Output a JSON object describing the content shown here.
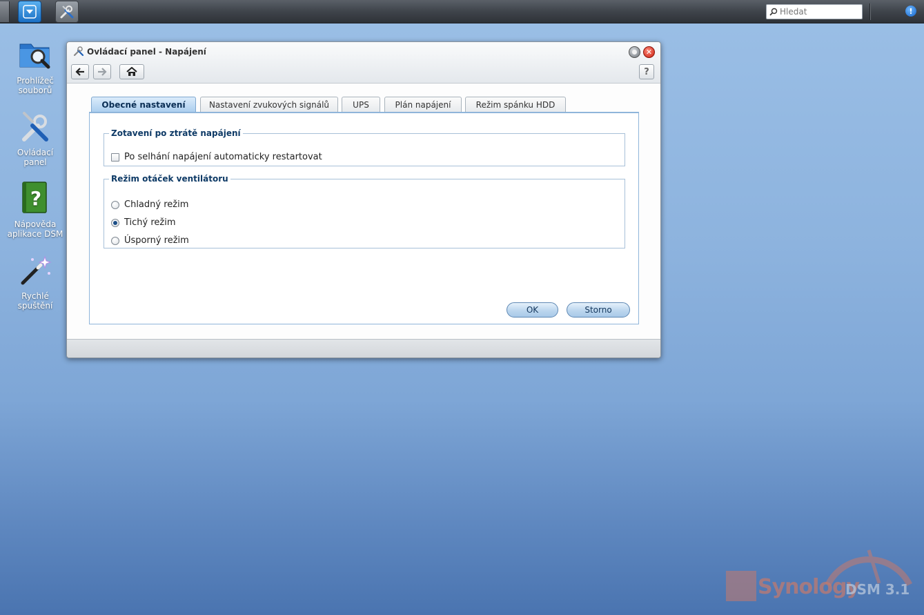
{
  "taskbar": {
    "search_placeholder": "Hledat",
    "start_icon": "chevron-down-icon",
    "app_icon": "tools-icon",
    "notify_icon": "info-icon",
    "notify_glyph": "!"
  },
  "desktop": {
    "icons": [
      {
        "label_line1": "Prohlížeč",
        "label_line2": "souborů",
        "icon": "folder-search-icon"
      },
      {
        "label_line1": "Ovládací",
        "label_line2": "panel",
        "icon": "tools-icon"
      },
      {
        "label_line1": "Nápověda",
        "label_line2": "aplikace DSM",
        "icon": "help-book-icon"
      },
      {
        "label_line1": "Rychlé",
        "label_line2": "spuštění",
        "icon": "magic-wand-icon"
      }
    ]
  },
  "window": {
    "title": "Ovládací panel - Napájení",
    "help_label": "?",
    "close_glyph": "✕",
    "tabs": [
      {
        "label": "Obecné nastavení",
        "active": true
      },
      {
        "label": "Nastavení zvukových signálů",
        "active": false
      },
      {
        "label": "UPS",
        "active": false
      },
      {
        "label": "Plán napájení",
        "active": false
      },
      {
        "label": "Režim spánku HDD",
        "active": false
      }
    ],
    "power_recovery": {
      "legend": "Zotavení po ztrátě napájení",
      "auto_restart_label": "Po selhání napájení automaticky restartovat",
      "auto_restart_checked": false
    },
    "fan_mode": {
      "legend": "Režim otáček ventilátoru",
      "options": [
        {
          "label": "Chladný režim",
          "checked": false
        },
        {
          "label": "Tichý režim",
          "checked": true
        },
        {
          "label": "Úsporný režim",
          "checked": false
        }
      ]
    },
    "ok_label": "OK",
    "cancel_label": "Storno"
  },
  "watermark": {
    "brand": "Synology",
    "product": "DSM 3.1"
  },
  "colors": {
    "desktop_top": "#9bbfe6",
    "desktop_bottom": "#4a74b0",
    "accent": "#0e3a66",
    "close_red": "#c91f10"
  }
}
